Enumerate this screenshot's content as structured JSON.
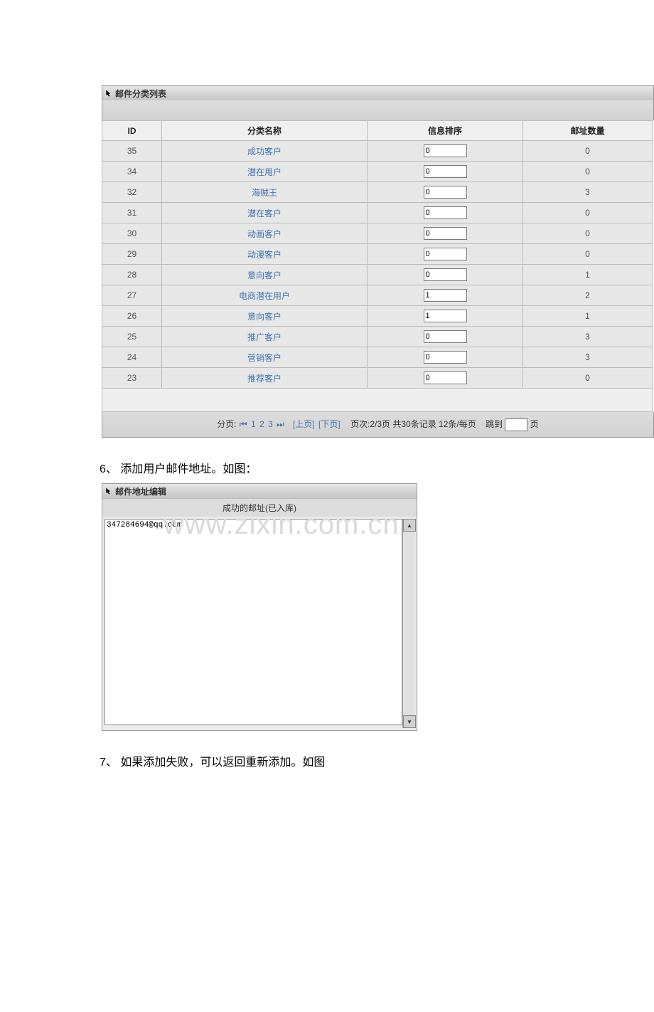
{
  "titlebar1": "邮件分类列表",
  "columns": {
    "id": "ID",
    "name": "分类名称",
    "sort": "信息排序",
    "count": "邮址数量"
  },
  "rows": [
    {
      "id": "35",
      "name": "成功客户",
      "sort": "0",
      "count": "0"
    },
    {
      "id": "34",
      "name": "潜在用户",
      "sort": "0",
      "count": "0"
    },
    {
      "id": "32",
      "name": "海贼王",
      "sort": "0",
      "count": "3"
    },
    {
      "id": "31",
      "name": "潜在客户",
      "sort": "0",
      "count": "0"
    },
    {
      "id": "30",
      "name": "动画客户",
      "sort": "0",
      "count": "0"
    },
    {
      "id": "29",
      "name": "动漫客户",
      "sort": "0",
      "count": "0"
    },
    {
      "id": "28",
      "name": "意向客户",
      "sort": "0",
      "count": "1"
    },
    {
      "id": "27",
      "name": "电商潜在用户",
      "sort": "1",
      "count": "2"
    },
    {
      "id": "26",
      "name": "意向客户",
      "sort": "1",
      "count": "1"
    },
    {
      "id": "25",
      "name": "推广客户",
      "sort": "0",
      "count": "3"
    },
    {
      "id": "24",
      "name": "营销客户",
      "sort": "0",
      "count": "3"
    },
    {
      "id": "23",
      "name": "推荐客户",
      "sort": "0",
      "count": "0"
    }
  ],
  "pager": {
    "label": "分页:",
    "first": "⏮",
    "p1": "1",
    "p2": "2",
    "p3": "3",
    "last": "⏭",
    "prev": "[上页]",
    "next": "[下页]",
    "info": "页次:2/3页 共30条记录 12条/每页",
    "jump": "跳到",
    "pgsuffix": "页"
  },
  "step6": "6、 添加用户邮件地址。如图：",
  "watermark": "www.zixin.com.cn",
  "panel2_title": "邮件地址编辑",
  "panel2_header": "成功的邮址(已入库)",
  "panel2_content": "347284694@qq.com",
  "step7": "7、 如果添加失败，可以返回重新添加。如图"
}
